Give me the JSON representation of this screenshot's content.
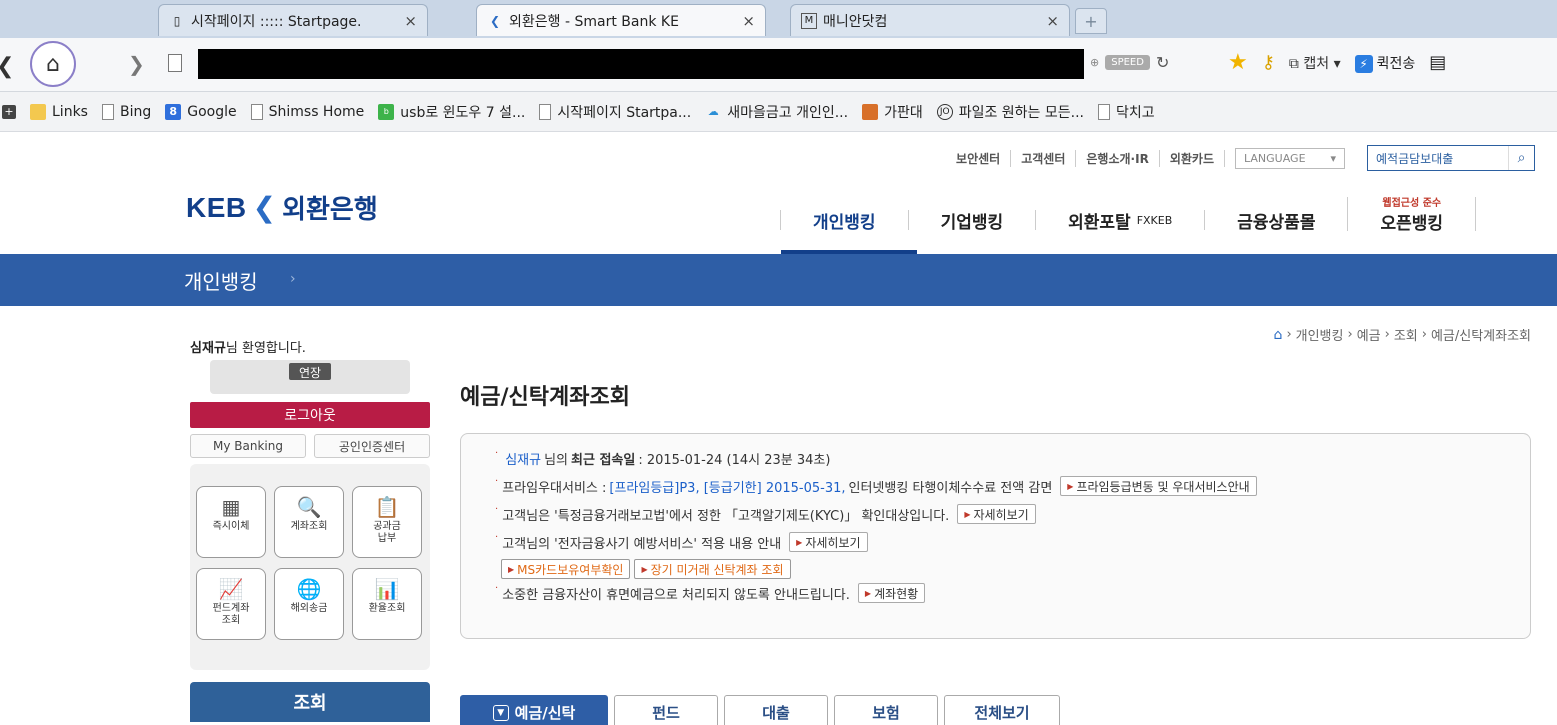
{
  "browser": {
    "tabs": [
      {
        "title": "시작페이지 ::::: Startpage.",
        "icon": "page-icon"
      },
      {
        "title": "외환은행 - Smart Bank KE",
        "icon": "keb-icon"
      },
      {
        "title": "매니안닷컴",
        "icon": "m-icon"
      }
    ],
    "speed_label": "SPEED",
    "capture_label": "캡처",
    "quicksend_label": "퀵전송",
    "bookmarks": [
      {
        "label": "Links",
        "icon": "folder-icon"
      },
      {
        "label": "Bing",
        "icon": "page-icon"
      },
      {
        "label": "Google",
        "icon": "google-icon"
      },
      {
        "label": "Shimss Home",
        "icon": "page-icon"
      },
      {
        "label": "usb로 윈도우 7 설...",
        "icon": "blog-icon"
      },
      {
        "label": "시작페이지 Startpa...",
        "icon": "page-icon"
      },
      {
        "label": "새마을금고 개인인...",
        "icon": "cloud-icon"
      },
      {
        "label": "가판대",
        "icon": "game-icon"
      },
      {
        "label": "파일조 원하는 모든...",
        "icon": "jo-icon"
      },
      {
        "label": "닥치고",
        "icon": "page-icon"
      }
    ]
  },
  "site": {
    "util_links": [
      "보안센터",
      "고객센터",
      "은행소개·IR",
      "외환카드"
    ],
    "language_label": "LANGUAGE",
    "search_placeholder": "예적금담보대출",
    "logo_brand": "KEB",
    "logo_korean": "외환은행",
    "gnb": {
      "personal": "개인뱅킹",
      "corporate": "기업뱅킹",
      "fx_portal": "외환포탈",
      "fx_portal_small": "FXKEB",
      "products": "금융상품몰",
      "open_tag": "웹접근성 준수",
      "open": "오픈뱅킹"
    },
    "banner_title": "개인뱅킹",
    "breadcrumb": [
      "개인뱅킹",
      "예금",
      "조회",
      "예금/신탁계좌조회"
    ]
  },
  "sidebar": {
    "user_name": "심재규",
    "welcome_suffix": "님 환영합니다.",
    "extend_label": "연장",
    "logout_label": "로그아웃",
    "my_banking_label": "My Banking",
    "cert_center_label": "공인인증센터",
    "quick_items": [
      {
        "label": "즉시이체",
        "icon": "calculator-icon",
        "glyph": "▦"
      },
      {
        "label": "계좌조회",
        "icon": "magnifier-icon",
        "glyph": "🔍"
      },
      {
        "label": "공과금\n납부",
        "icon": "clipboard-icon",
        "glyph": "📋"
      },
      {
        "label": "펀드계좌\n조회",
        "icon": "trend-up-icon",
        "glyph": "📈"
      },
      {
        "label": "해외송금",
        "icon": "globe-icon",
        "glyph": "🌐"
      },
      {
        "label": "환율조회",
        "icon": "bar-chart-icon",
        "glyph": "📊"
      }
    ],
    "inquiry_label": "조회"
  },
  "main": {
    "title": "예금/신탁계좌조회",
    "info": {
      "last_login_name": "심재규",
      "last_login_mid": "님의",
      "last_login_label": "최근 접속일",
      "last_login_value": ": 2015-01-24 (14시 23분 34초)",
      "prime_prefix": "프라임우대서비스 :",
      "prime_grade": "[프라임등급]P3, [등급기한] 2015-05-31,",
      "prime_suffix": "인터넷뱅킹 타행이체수수료 전액 감면",
      "prime_btn": "프라임등급변동 및 우대서비스안내",
      "kyc_text": "고객님은 '특정금융거래보고법'에서 정한 「고객알기제도(KYC)」 확인대상입니다.",
      "kyc_btn": "자세히보기",
      "efraud_text": "고객님의 '전자금융사기 예방서비스' 적용 내용 안내",
      "efraud_btn": "자세히보기",
      "ms_card_btn": "MS카드보유여부확인",
      "dormant_trust_btn": "장기 미거래 신탁계좌 조회",
      "dormant_text": "소중한 금융자산이 휴면예금으로 처리되지 않도록 안내드립니다.",
      "dormant_btn": "계좌현황"
    },
    "tabs": [
      "예금/신탁",
      "펀드",
      "대출",
      "보험",
      "전체보기"
    ]
  }
}
